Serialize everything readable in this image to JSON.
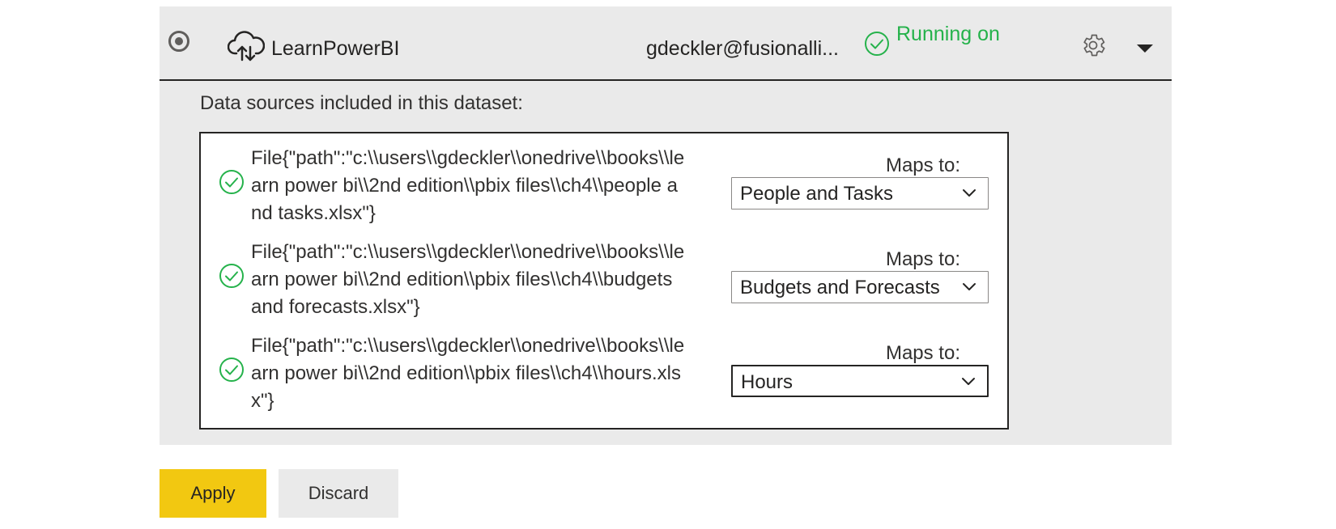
{
  "gateway": {
    "name": "LearnPowerBI",
    "account": "gdeckler@fusionalli...",
    "status": "Running on",
    "status_color": "#25b24b",
    "icons": [
      "radio-selected-icon",
      "cloud-upload-icon",
      "check-circle-icon",
      "gear-icon",
      "chevron-down-icon"
    ]
  },
  "sources": {
    "label": "Data sources included in this dataset:",
    "items": [
      {
        "path": "File{\"path\":\"c:\\\\users\\\\gdeckler\\\\onedrive\\\\books\\\\learn power bi\\\\2nd edition\\\\pbix files\\\\ch4\\\\people and tasks.xlsx\"}",
        "maps_label": "Maps to:",
        "selected": "People and Tasks"
      },
      {
        "path": "File{\"path\":\"c:\\\\users\\\\gdeckler\\\\onedrive\\\\books\\\\learn power bi\\\\2nd edition\\\\pbix files\\\\ch4\\\\budgets and forecasts.xlsx\"}",
        "maps_label": "Maps to:",
        "selected": "Budgets and Forecasts"
      },
      {
        "path": "File{\"path\":\"c:\\\\users\\\\gdeckler\\\\onedrive\\\\books\\\\learn power bi\\\\2nd edition\\\\pbix files\\\\ch4\\\\hours.xlsx\"}",
        "maps_label": "Maps to:",
        "selected": "Hours"
      }
    ]
  },
  "actions": {
    "apply_label": "Apply",
    "discard_label": "Discard",
    "apply_color": "#f2c811"
  }
}
